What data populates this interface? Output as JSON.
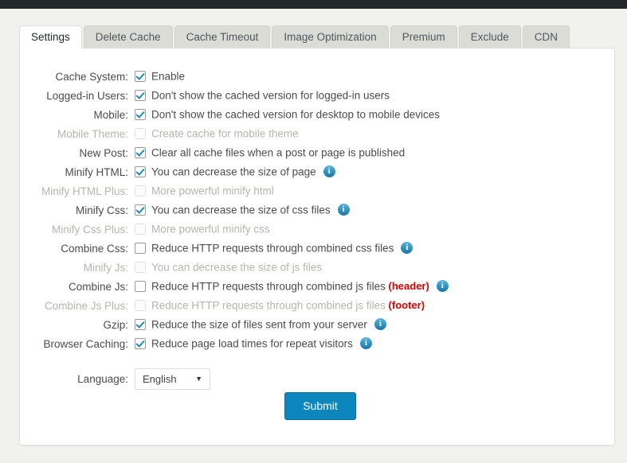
{
  "tabs": [
    {
      "label": "Settings",
      "active": true
    },
    {
      "label": "Delete Cache",
      "active": false
    },
    {
      "label": "Cache Timeout",
      "active": false
    },
    {
      "label": "Image Optimization",
      "active": false
    },
    {
      "label": "Premium",
      "active": false
    },
    {
      "label": "Exclude",
      "active": false
    },
    {
      "label": "CDN",
      "active": false
    }
  ],
  "colors": {
    "accent_blue": "#1e8cbe",
    "submit_blue": "#0d86bd",
    "tag_red": "#dd0000",
    "page_background": "#f1f1ed",
    "admin_bar": "#23282d"
  },
  "settings_rows": [
    {
      "label": "Cache System:",
      "description": "Enable",
      "checked": true,
      "disabled": false,
      "info": false,
      "tag": ""
    },
    {
      "label": "Logged-in Users:",
      "description": "Don't show the cached version for logged-in users",
      "checked": true,
      "disabled": false,
      "info": false,
      "tag": ""
    },
    {
      "label": "Mobile:",
      "description": "Don't show the cached version for desktop to mobile devices",
      "checked": true,
      "disabled": false,
      "info": false,
      "tag": ""
    },
    {
      "label": "Mobile Theme:",
      "description": "Create cache for mobile theme",
      "checked": false,
      "disabled": true,
      "info": false,
      "tag": ""
    },
    {
      "label": "New Post:",
      "description": "Clear all cache files when a post or page is published",
      "checked": true,
      "disabled": false,
      "info": false,
      "tag": ""
    },
    {
      "label": "Minify HTML:",
      "description": "You can decrease the size of page",
      "checked": true,
      "disabled": false,
      "info": true,
      "tag": ""
    },
    {
      "label": "Minify HTML Plus:",
      "description": "More powerful minify html",
      "checked": false,
      "disabled": true,
      "info": false,
      "tag": ""
    },
    {
      "label": "Minify Css:",
      "description": "You can decrease the size of css files",
      "checked": true,
      "disabled": false,
      "info": true,
      "tag": ""
    },
    {
      "label": "Minify Css Plus:",
      "description": "More powerful minify css",
      "checked": false,
      "disabled": true,
      "info": false,
      "tag": ""
    },
    {
      "label": "Combine Css:",
      "description": "Reduce HTTP requests through combined css files",
      "checked": false,
      "disabled": false,
      "info": true,
      "tag": ""
    },
    {
      "label": "Minify Js:",
      "description": "You can decrease the size of js files",
      "checked": false,
      "disabled": true,
      "info": false,
      "tag": ""
    },
    {
      "label": "Combine Js:",
      "description": "Reduce HTTP requests through combined js files",
      "checked": false,
      "disabled": false,
      "info": true,
      "tag": "(header)"
    },
    {
      "label": "Combine Js Plus:",
      "description": "Reduce HTTP requests through combined js files",
      "checked": false,
      "disabled": true,
      "info": false,
      "tag": "(footer)"
    },
    {
      "label": "Gzip:",
      "description": "Reduce the size of files sent from your server",
      "checked": true,
      "disabled": false,
      "info": true,
      "tag": ""
    },
    {
      "label": "Browser Caching:",
      "description": "Reduce page load times for repeat visitors",
      "checked": true,
      "disabled": false,
      "info": true,
      "tag": ""
    }
  ],
  "language": {
    "label": "Language:",
    "selected": "English",
    "options": [
      "English"
    ],
    "chevron": "chevron-down-icon"
  },
  "submit": {
    "label": "Submit"
  }
}
